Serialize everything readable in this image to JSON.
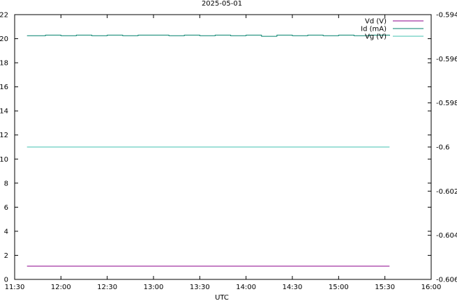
{
  "chart_data": {
    "type": "line",
    "title": "2025-05-01",
    "xlabel": "UTC",
    "ylabel": "",
    "y2label": "",
    "x_ticks": [
      "11:30",
      "12:00",
      "12:30",
      "13:00",
      "13:30",
      "14:00",
      "14:30",
      "15:00",
      "15:30",
      "16:00"
    ],
    "xlim": [
      "11:30",
      "16:00"
    ],
    "ylim": [
      0,
      22
    ],
    "y_ticks": [
      0,
      2,
      4,
      6,
      8,
      10,
      12,
      14,
      16,
      18,
      20,
      22
    ],
    "y2lim": [
      -0.606,
      -0.594
    ],
    "y2_ticks": [
      -0.606,
      -0.604,
      -0.602,
      -0.6,
      -0.598,
      -0.596,
      -0.594
    ],
    "y2_tick_labels": [
      "-0.606",
      "-0.604",
      "-0.602",
      "-0.6",
      "-0.598",
      "-0.596",
      "-0.594"
    ],
    "grid": false,
    "legend_position": "top-right",
    "series": [
      {
        "name": "Vd (V)",
        "axis": "left",
        "color": "#8b008b",
        "x": [
          "11:38",
          "15:33"
        ],
        "y": [
          1.1,
          1.1
        ]
      },
      {
        "name": "Id (mA)",
        "axis": "left",
        "color": "#00806b",
        "noisy": true,
        "x": [
          "11:38",
          "11:50",
          "12:00",
          "12:10",
          "12:20",
          "12:30",
          "12:40",
          "12:50",
          "13:00",
          "13:10",
          "13:20",
          "13:30",
          "13:40",
          "13:50",
          "14:00",
          "14:10",
          "14:20",
          "14:30",
          "14:40",
          "14:50",
          "15:00",
          "15:10",
          "15:20",
          "15:33"
        ],
        "y": [
          20.25,
          20.3,
          20.25,
          20.3,
          20.25,
          20.3,
          20.25,
          20.3,
          20.3,
          20.25,
          20.3,
          20.25,
          20.3,
          20.25,
          20.3,
          20.2,
          20.3,
          20.25,
          20.3,
          20.25,
          20.3,
          20.25,
          20.3,
          20.25
        ]
      },
      {
        "name": "Vg (V)",
        "axis": "right",
        "color": "#40c0b0",
        "x": [
          "11:38",
          "15:33"
        ],
        "y": [
          -0.6,
          -0.6
        ]
      }
    ]
  }
}
